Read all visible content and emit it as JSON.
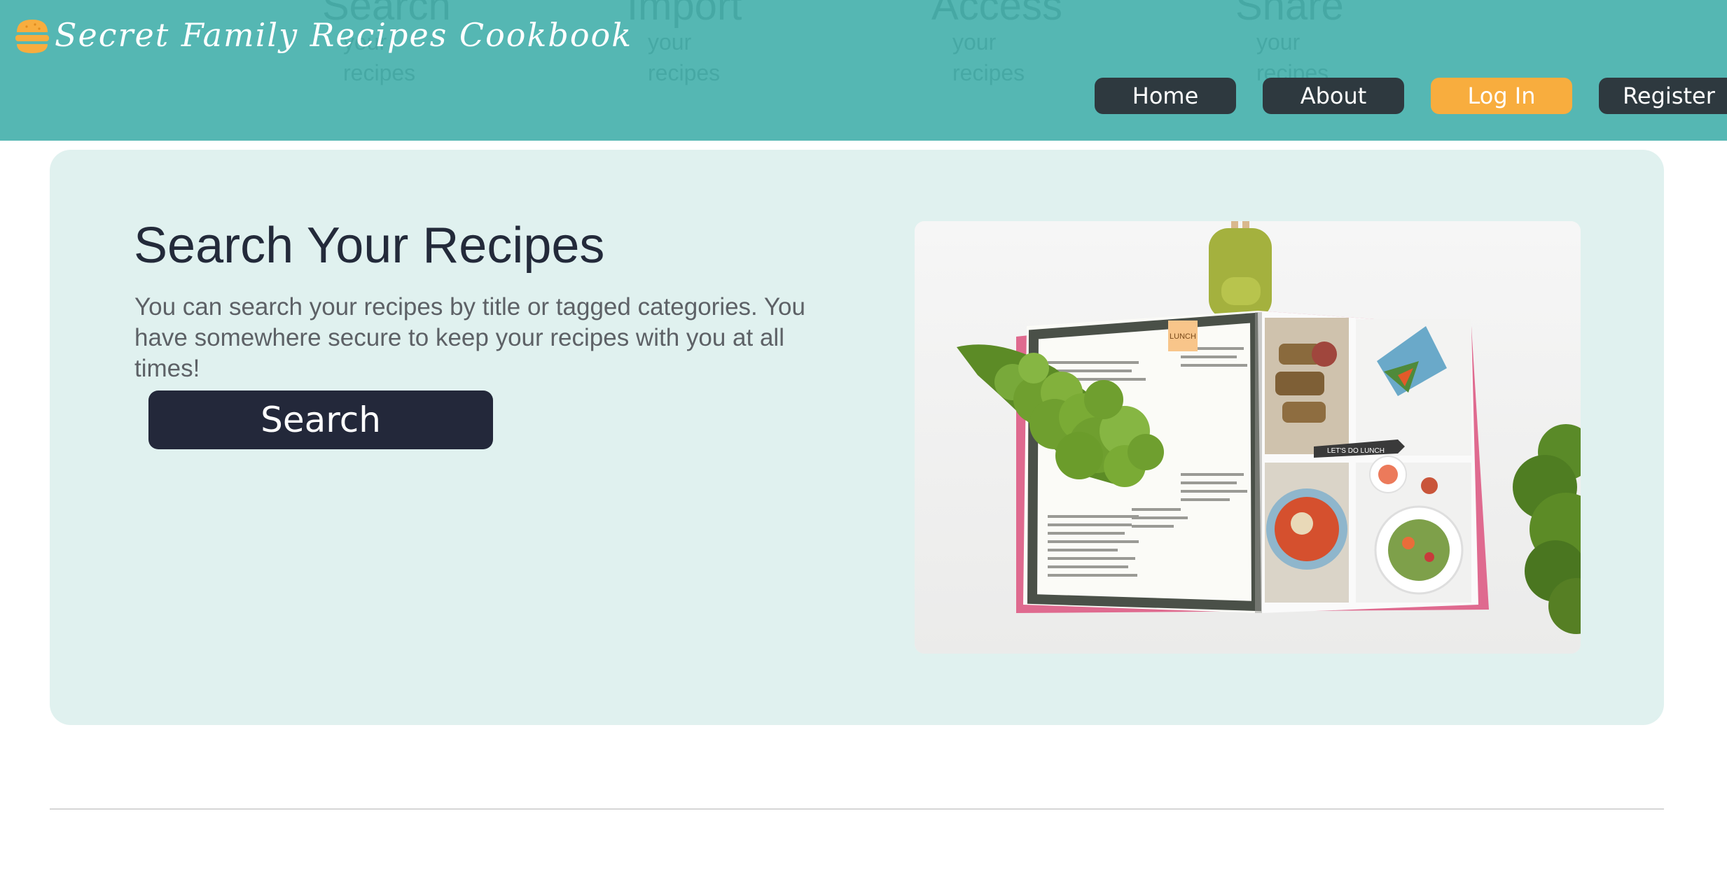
{
  "header": {
    "title": "Secret Family Recipes Cookbook",
    "logo_icon": "burger-icon",
    "colors": {
      "background": "#55b7b3",
      "accent": "#f8ad3e",
      "nav_dark": "#2e393f"
    }
  },
  "features": [
    {
      "heading": "Search",
      "sub": "your recipes"
    },
    {
      "heading": "Import",
      "sub": "your recipes"
    },
    {
      "heading": "Access",
      "sub": "your recipes"
    },
    {
      "heading": "Share",
      "sub": "your recipes"
    }
  ],
  "nav": {
    "home": "Home",
    "about": "About",
    "login": "Log In",
    "register": "Register"
  },
  "hero": {
    "title": "Search Your Recipes",
    "description": "You can search your recipes by title or tagged categories. You have somewhere secure to keep your recipes with you at all times!",
    "button_label": "Search",
    "image": {
      "label_lunch": "LUNCH",
      "label_lets_do_lunch": "LET'S DO LUNCH"
    },
    "colors": {
      "card_background": "#e0f1ef",
      "button": "#23283a"
    }
  }
}
